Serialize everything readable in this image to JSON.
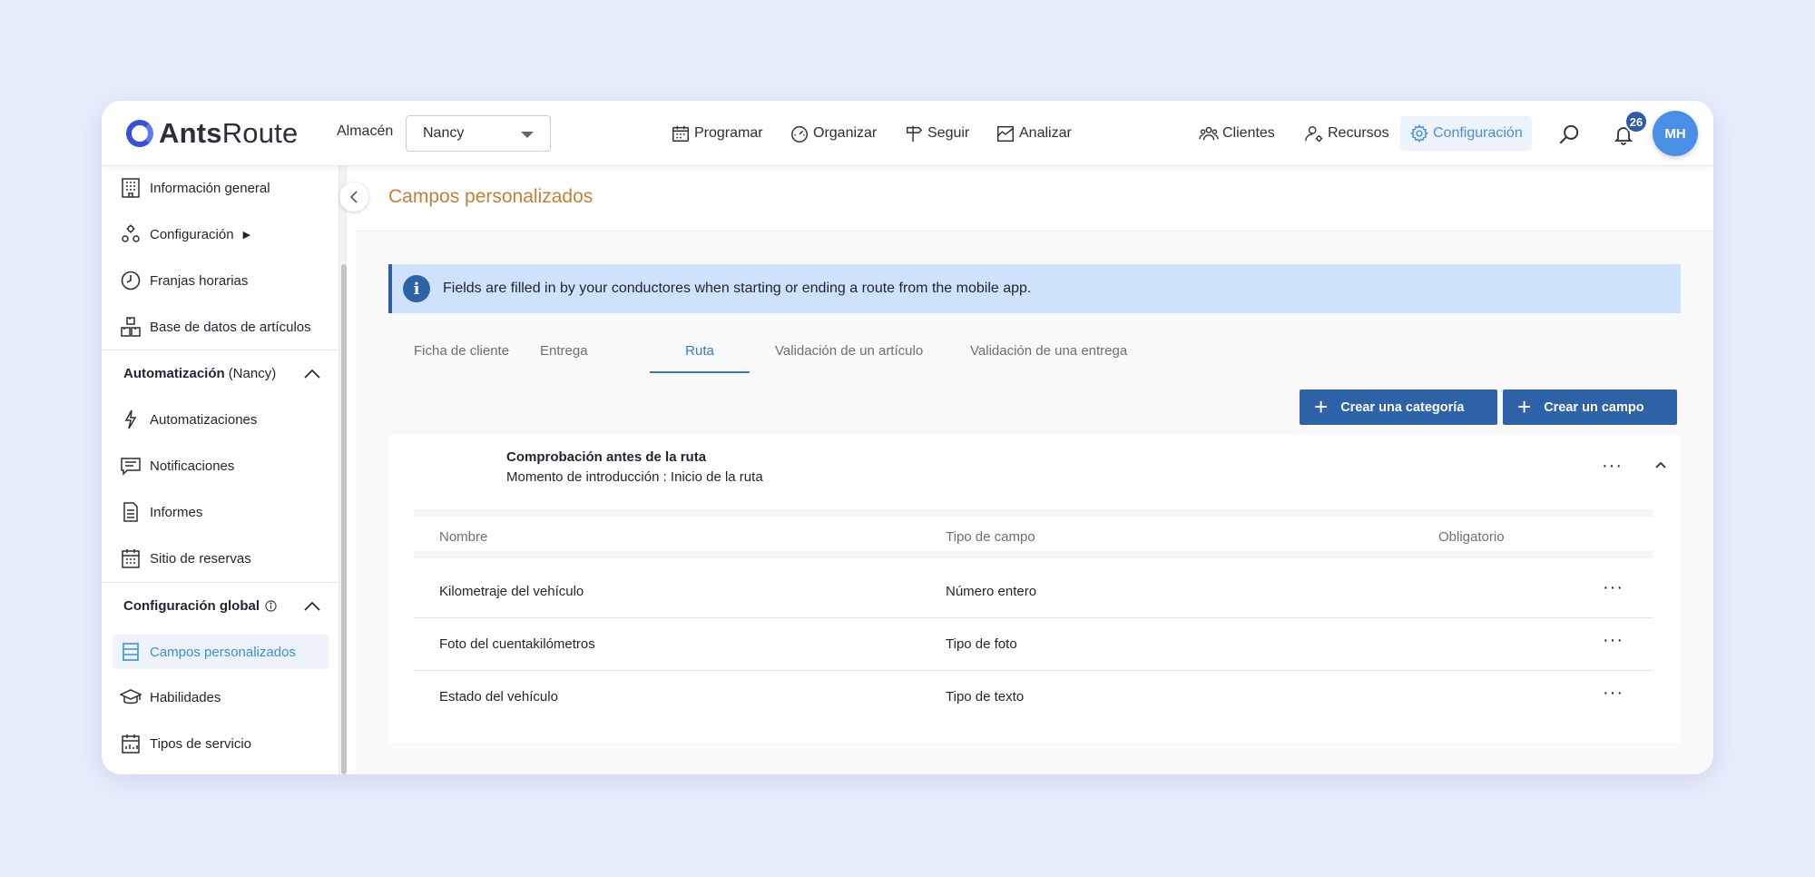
{
  "topbar": {
    "logo": {
      "part1": "Ants",
      "part2": "Route"
    },
    "store_label": "Almacén",
    "store_value": "Nancy",
    "nav": [
      "Programar",
      "Organizar",
      "Seguir",
      "Analizar"
    ],
    "right_nav": [
      "Clientes",
      "Recursos",
      "Configuración"
    ],
    "notifications_count": "26",
    "avatar_initials": "MH"
  },
  "sidebar": {
    "items_top": [
      "Información general",
      "Configuración",
      "Franjas horarias",
      "Base de datos de artículos"
    ],
    "config_arrow": "▶",
    "section_automation": {
      "title": "Automatización",
      "suffix": "(Nancy)"
    },
    "items_automation": [
      "Automatizaciones",
      "Notificaciones",
      "Informes",
      "Sitio de reservas"
    ],
    "section_global": {
      "title": "Configuración global"
    },
    "items_global": [
      "Campos personalizados",
      "Habilidades",
      "Tipos de servicio"
    ]
  },
  "main": {
    "title": "Campos personalizados",
    "info": "Fields are filled in by your conductores when starting or ending a route from the mobile app.",
    "tabs": [
      "Ficha de cliente",
      "Entrega",
      "Ruta",
      "Validación de un artículo",
      "Validación de una entrega"
    ],
    "active_tab": "Ruta",
    "buttons": {
      "create_category": "Crear una categoría",
      "create_field": "Crear un campo"
    },
    "category": {
      "title": "Comprobación antes de la ruta",
      "subtitle": "Momento de introducción : Inicio de la ruta"
    },
    "table": {
      "headers": [
        "Nombre",
        "Tipo de campo",
        "Obligatorio"
      ],
      "rows": [
        {
          "name": "Kilometraje del vehículo",
          "type": "Número entero"
        },
        {
          "name": "Foto del cuentakilómetros",
          "type": "Tipo de foto"
        },
        {
          "name": "Estado del vehículo",
          "type": "Tipo de texto"
        }
      ]
    },
    "more_glyph": "···"
  }
}
